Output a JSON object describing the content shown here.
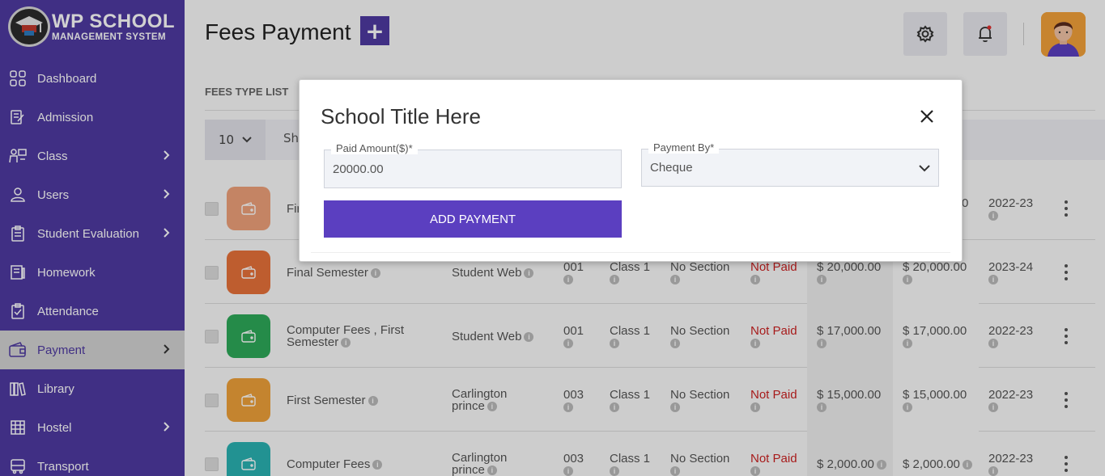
{
  "app": {
    "logo_title": "WP SCHOOL",
    "logo_subtitle": "MANAGEMENT SYSTEM"
  },
  "sidebar": {
    "items": [
      {
        "label": "Dashboard",
        "icon": "dashboard-icon",
        "has_submenu": false
      },
      {
        "label": "Admission",
        "icon": "admission-icon",
        "has_submenu": false
      },
      {
        "label": "Class",
        "icon": "class-icon",
        "has_submenu": true
      },
      {
        "label": "Users",
        "icon": "user-icon",
        "has_submenu": true
      },
      {
        "label": "Student Evaluation",
        "icon": "clipboard-icon",
        "has_submenu": true
      },
      {
        "label": "Homework",
        "icon": "homework-icon",
        "has_submenu": false
      },
      {
        "label": "Attendance",
        "icon": "attendance-icon",
        "has_submenu": false
      },
      {
        "label": "Payment",
        "icon": "wallet-icon",
        "has_submenu": true,
        "active": true
      },
      {
        "label": "Library",
        "icon": "library-icon",
        "has_submenu": false
      },
      {
        "label": "Hostel",
        "icon": "hostel-icon",
        "has_submenu": true
      },
      {
        "label": "Transport",
        "icon": "bus-icon",
        "has_submenu": false
      }
    ]
  },
  "header": {
    "title": "Fees Payment",
    "add_label": "+"
  },
  "list": {
    "section_label": "FEES TYPE LIST",
    "per_page": "10",
    "show_text": "Sh",
    "rows": [
      {
        "fee_type": "Fir",
        "student": "",
        "roll": "",
        "class": "",
        "section": "",
        "status": "",
        "total": "",
        "due": "0",
        "session": "2022-23",
        "color": "#f0a27a"
      },
      {
        "fee_type": "Final Semester",
        "student": "Student Web",
        "roll": "001",
        "class": "Class 1",
        "section": "No Section",
        "status": "Not Paid",
        "total": "$ 20,000.00",
        "due": "$ 20,000.00",
        "session": "2023-24",
        "color": "#e8723a"
      },
      {
        "fee_type": "Computer Fees , First Semester",
        "student": "Student Web",
        "roll": "001",
        "class": "Class 1",
        "section": "No Section",
        "status": "Not Paid",
        "total": "$ 17,000.00",
        "due": "$ 17,000.00",
        "session": "2022-23",
        "color": "#2eaa5a"
      },
      {
        "fee_type": "First Semester",
        "student": "Carlington prince",
        "roll": "003",
        "class": "Class 1",
        "section": "No Section",
        "status": "Not Paid",
        "total": "$ 15,000.00",
        "due": "$ 15,000.00",
        "session": "2022-23",
        "color": "#f0a23a"
      },
      {
        "fee_type": "Computer Fees",
        "student": "Carlington prince",
        "roll": "003",
        "class": "Class 1",
        "section": "No Section",
        "status": "Not Paid",
        "total": "$ 2,000.00",
        "due": "$ 2,000.00",
        "session": "2022-23",
        "color": "#2ab3b3"
      }
    ]
  },
  "modal": {
    "title": "School Title Here",
    "paid_amount_label": "Paid Amount($)*",
    "paid_amount_value": "20000.00",
    "payment_by_label": "Payment By*",
    "payment_by_value": "Cheque",
    "submit_label": "ADD PAYMENT"
  },
  "colors": {
    "brand": "#4f3aa2",
    "button": "#5b3fc0",
    "status_not_paid": "#cc2222"
  }
}
